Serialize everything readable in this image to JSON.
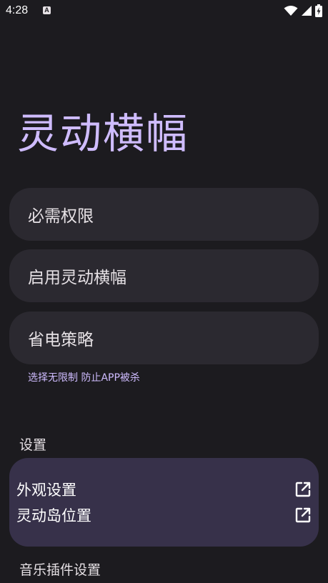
{
  "status_bar": {
    "time": "4:28",
    "notification_icon": "A",
    "icons": [
      "wifi-icon",
      "signal-icon",
      "battery-charging-icon"
    ]
  },
  "app": {
    "title": "灵动横幅"
  },
  "cards": {
    "permissions": "必需权限",
    "enable": "启用灵动横幅",
    "power": "省电策略"
  },
  "power_hint": "选择无限制 防止APP被杀",
  "settings": {
    "section_label": "设置",
    "items": [
      {
        "label": "外观设置",
        "icon": "open-external-icon"
      },
      {
        "label": "灵动岛位置",
        "icon": "open-external-icon"
      }
    ]
  },
  "music": {
    "section_label": "音乐插件设置"
  },
  "colors": {
    "background": "#1c1b1f",
    "card": "#2b2930",
    "settings_card": "#37314a",
    "accent": "#cfbcff",
    "text": "#e6e1e5"
  }
}
